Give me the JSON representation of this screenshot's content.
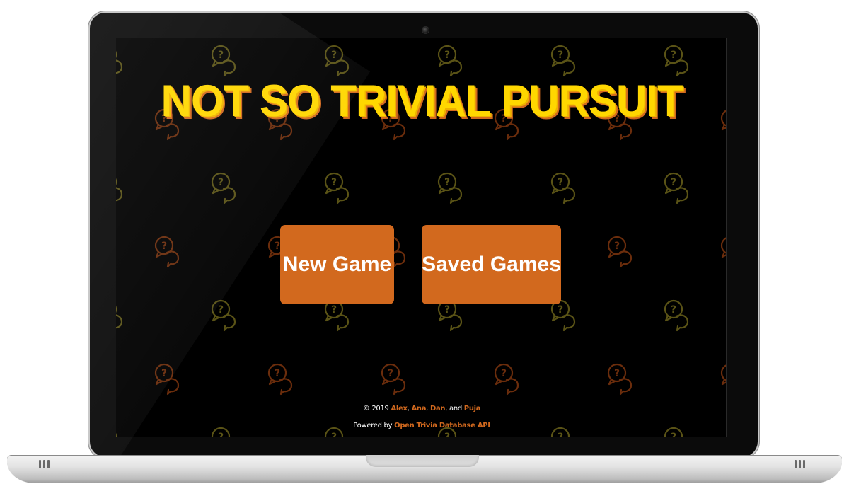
{
  "app": {
    "title": "NOT SO TRIVIAL PURSUIT",
    "accent_color": "#d2691e",
    "title_color": "#ffd700",
    "background_icon": "question-chat-bubbles-icon"
  },
  "menu": {
    "new_game_label": "New Game",
    "saved_games_label": "Saved Games"
  },
  "footer": {
    "copyright_prefix": "© 2019",
    "authors": [
      "Alex",
      "Ana",
      "Dan",
      "Puja"
    ],
    "sep1": ",",
    "sep2": ",",
    "sep3": ", and",
    "powered_prefix": "Powered by",
    "api_link": "Open Trivia Database API"
  }
}
